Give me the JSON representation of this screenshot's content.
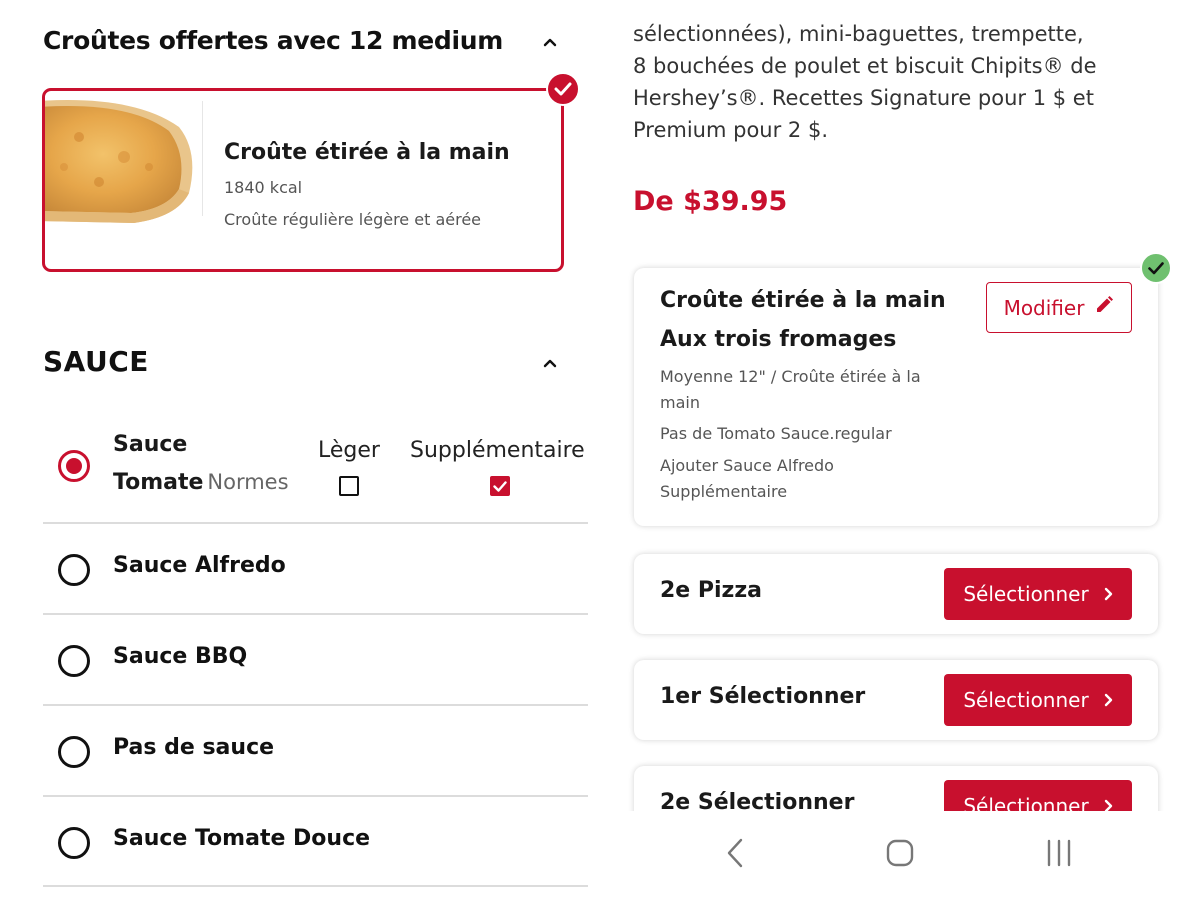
{
  "crust_section": {
    "title": "Croûtes offertes avec 12 medium",
    "card": {
      "name": "Croûte étirée à la main",
      "kcal": "1840 kcal",
      "description": "Croûte régulière légère et aérée"
    }
  },
  "sauce_section": {
    "title": "SAUCE",
    "option_light": "Lèger",
    "option_extra": "Supplémentaire",
    "selected": {
      "line1": "Sauce",
      "line2": "Tomate",
      "suffix": "Normes",
      "light_checked": false,
      "extra_checked": true
    },
    "others": [
      "Sauce Alfredo",
      "Sauce BBQ",
      "Pas de sauce",
      "Sauce Tomate Douce"
    ]
  },
  "description": "sélectionnées), mini-baguettes, trempette, 8 bouchées de poulet et biscuit Chipits® de Hershey’s®. Recettes Signature pour 1 $ et Premium pour 2 $.",
  "price": "De $39.95",
  "pizza1": {
    "line1": "Croûte étirée à la main",
    "line2": "Aux trois fromages",
    "detail1": "Moyenne 12\" / Croûte étirée à la main",
    "detail2": "Pas de Tomato Sauce.regular",
    "detail3": "Ajouter Sauce Alfredo Supplémentaire",
    "modify_label": "Modifier"
  },
  "items": [
    {
      "title": "2e Pizza",
      "button": "Sélectionner"
    },
    {
      "title": "1er Sélectionner",
      "button": "Sélectionner"
    },
    {
      "title": "2e Sélectionner",
      "button": "Sélectionner"
    }
  ],
  "colors": {
    "accent": "#c8102e",
    "check_green": "#6fc06f"
  },
  "icons": {
    "nav": [
      "back-icon",
      "home-icon",
      "recent-apps-icon"
    ]
  }
}
